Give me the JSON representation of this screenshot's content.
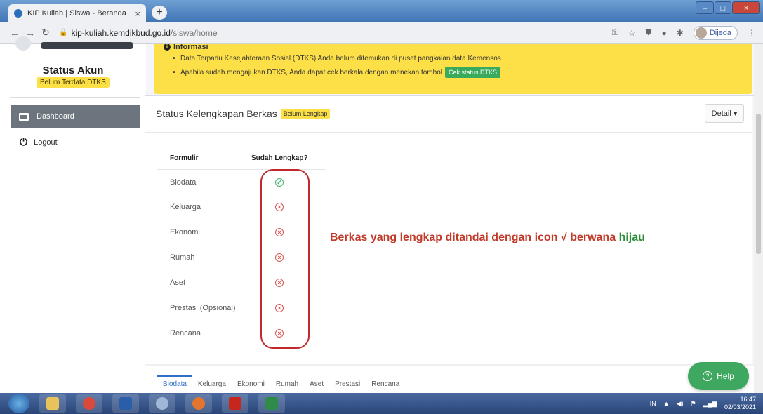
{
  "browser": {
    "tab_title": "KIP Kuliah | Siswa - Beranda",
    "tab_close": "×",
    "new_tab": "+",
    "url_host": "kip-kuliah.kemdikbud.go.id",
    "url_path": "/siswa/home",
    "profile_name": "Dijeda"
  },
  "sidebar": {
    "status_title": "Status Akun",
    "status_badge": "Belum Terdata DTKS",
    "nav_dashboard": "Dashboard",
    "nav_logout": "Logout"
  },
  "info": {
    "heading": "Informasi",
    "line1": "Data Terpadu Kesejahteraan Sosial (DTKS) Anda belum ditemukan di pusat pangkalan data Kemensos.",
    "line2": "Apabila sudah mengajukan DTKS, Anda dapat cek berkala dengan menekan tombol",
    "cek_button": "Cek status DTKS"
  },
  "card": {
    "title": "Status Kelengkapan Berkas",
    "status_badge": "Belum Lengkap",
    "detail_button": "Detail ▾",
    "col_form": "Formulir",
    "col_status": "Sudah Lengkap?",
    "rows": [
      {
        "label": "Biodata",
        "status": "✓"
      },
      {
        "label": "Keluarga",
        "status": "×"
      },
      {
        "label": "Ekonomi",
        "status": "×"
      },
      {
        "label": "Rumah",
        "status": "×"
      },
      {
        "label": "Aset",
        "status": "×"
      },
      {
        "label": "Prestasi (Opsional)",
        "status": "×"
      },
      {
        "label": "Rencana",
        "status": "×"
      }
    ]
  },
  "annotation": {
    "text": "Berkas yang lengkap ditandai dengan icon √ berwana",
    "highlight": "hijau"
  },
  "bottom_tabs": [
    "Biodata",
    "Keluarga",
    "Ekonomi",
    "Rumah",
    "Aset",
    "Prestasi",
    "Rencana"
  ],
  "help_button": "Help",
  "taskbar": {
    "lang": "IN",
    "time": "16:47",
    "date": "02/03/2021"
  },
  "colors": {
    "info_yellow": "#fde047",
    "ok_green": "#41b36a",
    "bad_red": "#d9534f",
    "annotation_red": "#c23a2a",
    "help_green": "#3ea860"
  }
}
